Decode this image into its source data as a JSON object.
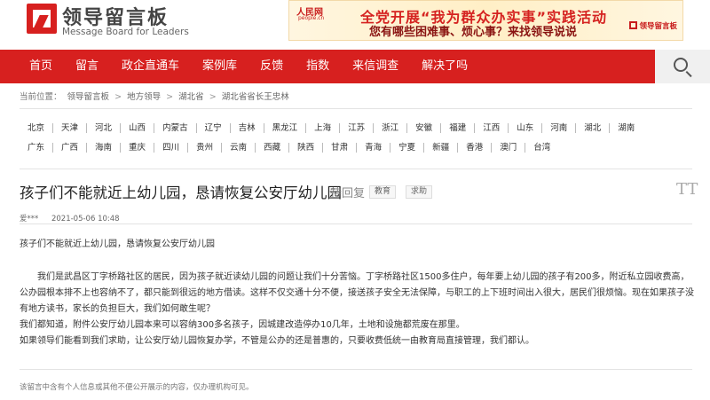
{
  "header": {
    "logo_title": "领导留言板",
    "logo_subtitle": "Message Board for Leaders"
  },
  "banner": {
    "brand": "人民网",
    "brand_url": "people.cn",
    "line1": "全党开展“我为群众办实事”实践活动",
    "line2": "您有哪些困难事、烦心事？来找领导说说",
    "badge": "领导留言板"
  },
  "nav": {
    "items": [
      "首页",
      "留言",
      "政企直通车",
      "案例库",
      "反馈",
      "指数",
      "来信调查",
      "解决了吗"
    ],
    "search_icon": "search-icon"
  },
  "breadcrumb": {
    "label": "当前位置：",
    "items": [
      "领导留言板",
      "地方领导",
      "湖北省",
      "湖北省省长王忠林"
    ],
    "separator": ">"
  },
  "regions": {
    "row1": [
      "北京",
      "天津",
      "河北",
      "山西",
      "内蒙古",
      "辽宁",
      "吉林",
      "黑龙江",
      "上海",
      "江苏",
      "浙江",
      "安徽",
      "福建",
      "江西",
      "山东",
      "河南",
      "湖北",
      "湖南"
    ],
    "row2": [
      "广东",
      "广西",
      "海南",
      "重庆",
      "四川",
      "贵州",
      "云南",
      "西藏",
      "陕西",
      "甘肃",
      "青海",
      "宁夏",
      "新疆",
      "香港",
      "澳门",
      "台湾"
    ]
  },
  "article": {
    "title": "孩子们不能就近上幼儿园，恳请恢复公安厅幼儿园",
    "status": "待回复",
    "tags": [
      "教育",
      "求助"
    ],
    "font_toggle": "TT",
    "author": "爱***",
    "date": "2021-05-06 10:48",
    "summary": "孩子们不能就近上幼儿园，恳请恢复公安厅幼儿园",
    "paragraphs": [
      "我们是武昌区丁字桥路社区的居民，因为孩子就近读幼儿园的问题让我们十分苦恼。丁字桥路社区1500多住户，每年要上幼儿园的孩子有200多，附近私立园收费高，公办园根本排不上也容纳不了，都只能到很远的地方借读。这样不仅交通十分不便，接送孩子安全无法保障，与职工的上下班时间出入很大，居民们很烦恼。现在如果孩子没有地方读书，家长的负担巨大，我们如何敢生呢？",
      "我们都知道，附件公安厅幼儿园本来可以容纳300多名孩子，因城建改造停办10几年，土地和设施都荒废在那里。",
      "如果领导们能看到我们求助，让公安厅幼儿园恢复办学，不管是公办的还是普惠的，只要收费低统一由教育局直接管理，我们都认。"
    ],
    "notice": "该留言中含有个人信息或其他不便公开展示的内容，仅办理机构可见。"
  }
}
